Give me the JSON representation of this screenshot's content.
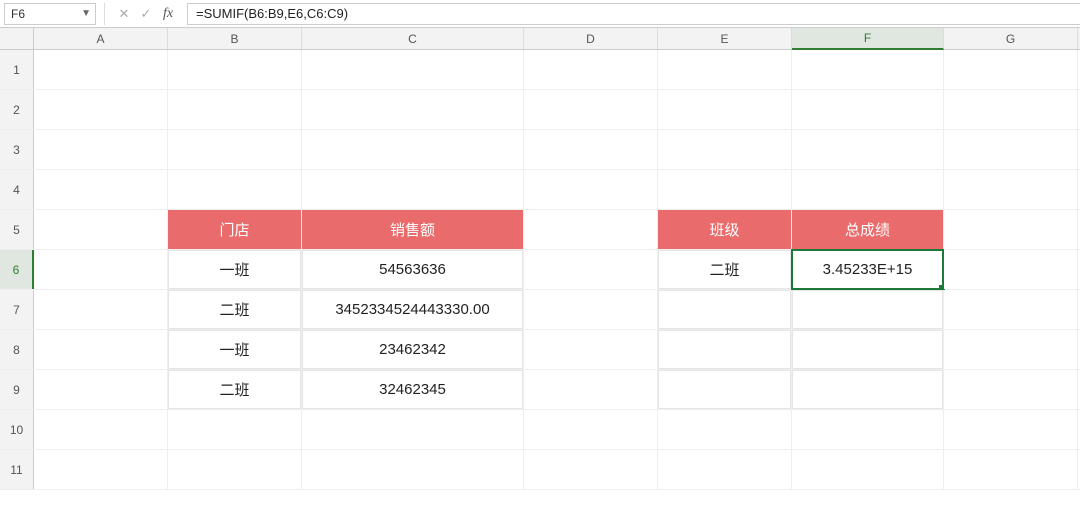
{
  "formula_bar": {
    "cell_ref": "F6",
    "fx_label": "fx",
    "formula": "=SUMIF(B6:B9,E6,C6:C9)"
  },
  "columns": [
    "A",
    "B",
    "C",
    "D",
    "E",
    "F",
    "G"
  ],
  "rows": [
    "1",
    "2",
    "3",
    "4",
    "5",
    "6",
    "7",
    "8",
    "9",
    "10",
    "11"
  ],
  "active": {
    "col": "F",
    "row": "6"
  },
  "left_table": {
    "headers": {
      "store": "门店",
      "sales": "销售额"
    },
    "rows": [
      {
        "store": "一班",
        "sales": "54563636"
      },
      {
        "store": "二班",
        "sales": "3452334524443330.00"
      },
      {
        "store": "一班",
        "sales": "23462342"
      },
      {
        "store": "二班",
        "sales": "32462345"
      }
    ]
  },
  "right_table": {
    "headers": {
      "class": "班级",
      "total": "总成绩"
    },
    "rows": [
      {
        "class": "二班",
        "total": "3.45233E+15"
      }
    ]
  },
  "chart_data": {
    "type": "table",
    "tables": [
      {
        "title": "门店/销售额",
        "columns": [
          "门店",
          "销售额"
        ],
        "rows": [
          [
            "一班",
            54563636
          ],
          [
            "二班",
            3452334524443330
          ],
          [
            "一班",
            23462342
          ],
          [
            "二班",
            32462345
          ]
        ]
      },
      {
        "title": "班级/总成绩",
        "columns": [
          "班级",
          "总成绩"
        ],
        "rows": [
          [
            "二班",
            3452330000000000.0
          ]
        ]
      }
    ]
  }
}
